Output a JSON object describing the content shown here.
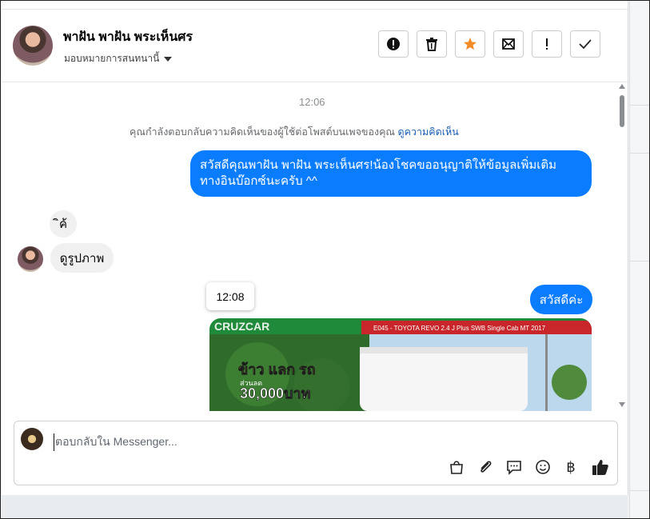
{
  "header": {
    "name": "พาฝัน พาฝัน พระเห็นศร",
    "assign_label": "มอบหมายการสนทนานี้"
  },
  "chat": {
    "time_1": "12:06",
    "notice_text": "คุณกำลังตอบกลับความคิดเห็นของผู้ใช้ต่อโพสต์บนเพจของคุณ",
    "notice_link": "ดูความคิดเห็น",
    "outgoing_1_line1": "สวัสดีคุณพาฝัน พาฝัน พระเห็นศร!น้องโชคขออนุญาติให้ข้อมูลเพิ่มเติม",
    "outgoing_1_line2": "ทางอินบ๊อกซ์นะครับ ^^",
    "incoming_1": "ิค้",
    "incoming_2": "ดูรูปภาพ",
    "tooltip_time": "12:08",
    "outgoing_2": "สวัสดีค่ะ",
    "photo_text_top": "CRUZCAR",
    "photo_caption": "E045 - TOYOTA REVO 2.4 J Plus SWB Single Cab MT 2017",
    "photo_promo_1": "ข้าว แลก รถ",
    "photo_promo_2": "ส่วนลด",
    "photo_promo_3": "30,000บาท"
  },
  "composer": {
    "placeholder": "ตอบกลับใน Messenger...",
    "baht_symbol": "฿"
  },
  "colors": {
    "accent": "#0a7cff",
    "star": "#f28c28"
  }
}
